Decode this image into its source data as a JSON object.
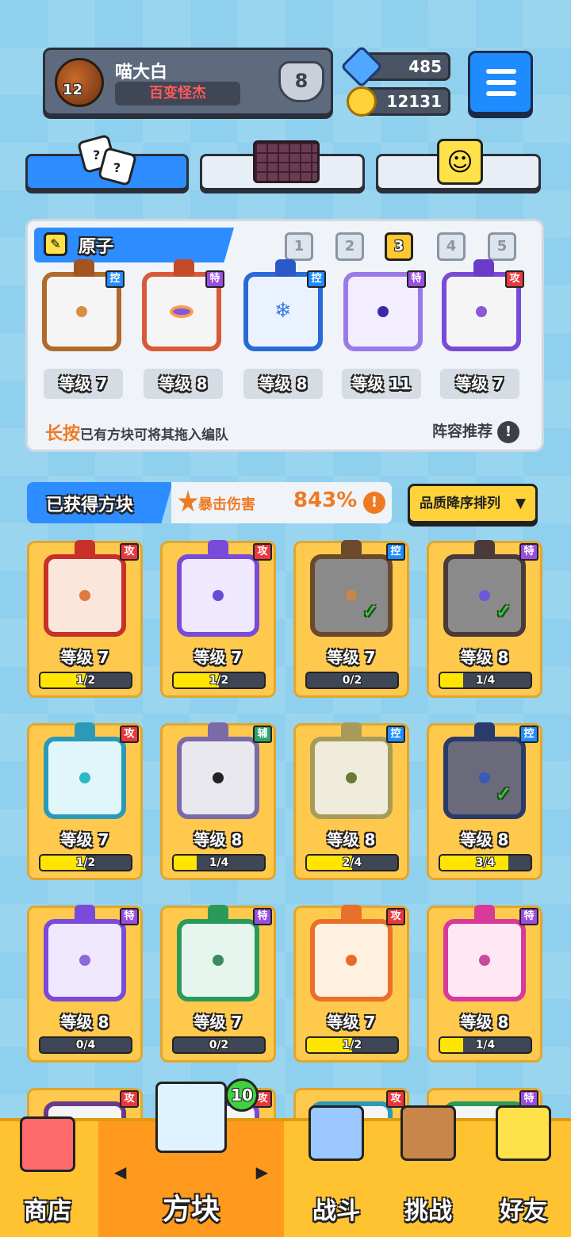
{
  "player": {
    "name": "喵大白",
    "title": "百变怪杰",
    "level": "12",
    "rank": "8"
  },
  "currency": {
    "gems": "485",
    "coins": "12131"
  },
  "colors": {
    "accent": "#2d8cff",
    "card_bg": "#ffc94d",
    "attack": "#e8383d",
    "control": "#1e8cff",
    "special": "#9a4de0",
    "support": "#2ba36a"
  },
  "team": {
    "title": "原子",
    "slots": [
      "1",
      "2",
      "3",
      "4",
      "5"
    ],
    "active_slot": "3",
    "blocks": [
      {
        "tag": "控",
        "level": "等级 7"
      },
      {
        "tag": "特",
        "level": "等级 8"
      },
      {
        "tag": "控",
        "level": "等级 8"
      },
      {
        "tag": "特",
        "level": "等级 11"
      },
      {
        "tag": "攻",
        "level": "等级 7"
      }
    ],
    "hint_highlight": "长按",
    "hint_text": "已有方块可将其拖入编队",
    "recommend_label": "阵容推荐",
    "recommend_icon": "!"
  },
  "owned": {
    "title": "已获得方块",
    "crit_label": "暴击伤害",
    "crit_value": "843%",
    "crit_info": "!",
    "sort_label": "品质降序排列",
    "sort_arrow": "▼",
    "check_mark": "✓",
    "cards": [
      {
        "tag": "攻",
        "level": "等级 7",
        "progress": "1/2",
        "fill": 0.5
      },
      {
        "tag": "攻",
        "level": "等级 7",
        "progress": "1/2",
        "fill": 0.5
      },
      {
        "tag": "控",
        "level": "等级 7",
        "progress": "0/2",
        "fill": 0
      },
      {
        "tag": "特",
        "level": "等级 8",
        "progress": "1/4",
        "fill": 0.25
      },
      {
        "tag": "攻",
        "level": "等级 7",
        "progress": "1/2",
        "fill": 0.5
      },
      {
        "tag": "辅",
        "level": "等级 8",
        "progress": "1/4",
        "fill": 0.25
      },
      {
        "tag": "控",
        "level": "等级 8",
        "progress": "2/4",
        "fill": 0.5
      },
      {
        "tag": "控",
        "level": "等级 8",
        "progress": "3/4",
        "fill": 0.75
      },
      {
        "tag": "特",
        "level": "等级 8",
        "progress": "0/4",
        "fill": 0
      },
      {
        "tag": "特",
        "level": "等级 7",
        "progress": "0/2",
        "fill": 0
      },
      {
        "tag": "攻",
        "level": "等级 7",
        "progress": "1/2",
        "fill": 0.5
      },
      {
        "tag": "特",
        "level": "等级 8",
        "progress": "1/4",
        "fill": 0.25
      }
    ],
    "partial_tags": [
      "攻",
      "攻",
      "攻",
      "特"
    ]
  },
  "nav": {
    "items": [
      "商店",
      "方块",
      "战斗",
      "挑战",
      "好友"
    ],
    "badge": "10",
    "arrow_left": "◀",
    "arrow_right": "▶"
  }
}
